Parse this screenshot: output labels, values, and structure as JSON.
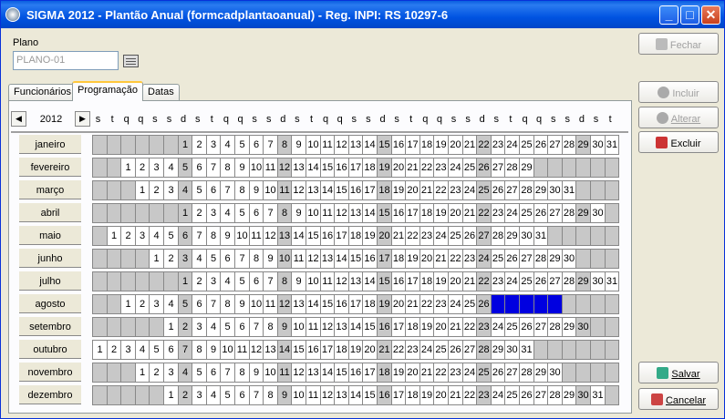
{
  "window": {
    "title": "SIGMA 2012 - Plantão Anual  (formcadplantaoanual)  - Reg. INPI: RS 10297-6"
  },
  "plano": {
    "label": "Plano",
    "value": "PLANO-01"
  },
  "tabs": [
    {
      "label": "Funcionários"
    },
    {
      "label": "Programação"
    },
    {
      "label": "Datas"
    }
  ],
  "calendar": {
    "year": "2012",
    "weekdays": [
      "s",
      "t",
      "q",
      "q",
      "s",
      "s",
      "d",
      "s",
      "t",
      "q",
      "q",
      "s",
      "s",
      "d",
      "s",
      "t",
      "q",
      "q",
      "s",
      "s",
      "d",
      "s",
      "t",
      "q",
      "q",
      "s",
      "s",
      "d",
      "s",
      "t",
      "q",
      "q",
      "s",
      "s",
      "d",
      "s",
      "t"
    ],
    "months": [
      {
        "name": "janeiro",
        "offset": 6,
        "days": 31
      },
      {
        "name": "fevereiro",
        "offset": 2,
        "days": 29
      },
      {
        "name": "março",
        "offset": 3,
        "days": 31
      },
      {
        "name": "abril",
        "offset": 6,
        "days": 30
      },
      {
        "name": "maio",
        "offset": 1,
        "days": 31
      },
      {
        "name": "junho",
        "offset": 4,
        "days": 30
      },
      {
        "name": "julho",
        "offset": 6,
        "days": 31
      },
      {
        "name": "agosto",
        "offset": 2,
        "days": 31,
        "selected": [
          27,
          28,
          29,
          30,
          31
        ]
      },
      {
        "name": "setembro",
        "offset": 5,
        "days": 30
      },
      {
        "name": "outubro",
        "offset": 0,
        "days": 31
      },
      {
        "name": "novembro",
        "offset": 3,
        "days": 30
      },
      {
        "name": "dezembro",
        "offset": 5,
        "days": 31
      }
    ]
  },
  "buttons": {
    "fechar": "Fechar",
    "incluir": "Incluir",
    "alterar": "Alterar",
    "excluir": "Excluir",
    "salvar": "Salvar",
    "cancelar": "Cancelar"
  },
  "colors": {
    "selected": "#0000e0",
    "weekend": "#c8c8c8",
    "title": "#0053e1"
  }
}
